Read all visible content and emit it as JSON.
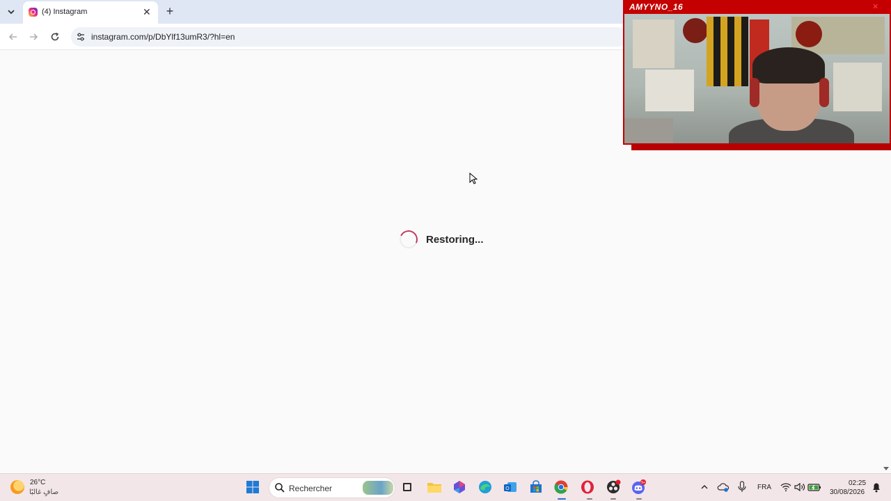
{
  "browser": {
    "tab_title": "(4) Instagram",
    "url": "instagram.com/p/DbYlf13umR3/?hl=en"
  },
  "page": {
    "loading_text": "Restoring..."
  },
  "webcam": {
    "streamer_name": "AMYYNO_16"
  },
  "taskbar": {
    "weather_temp": "26°C",
    "weather_desc": "صافٍ غالبًا",
    "search_placeholder": "Rechercher",
    "language": "FRA",
    "time": "02:25",
    "date": "30/08/2026",
    "discord_badge": "9+"
  }
}
